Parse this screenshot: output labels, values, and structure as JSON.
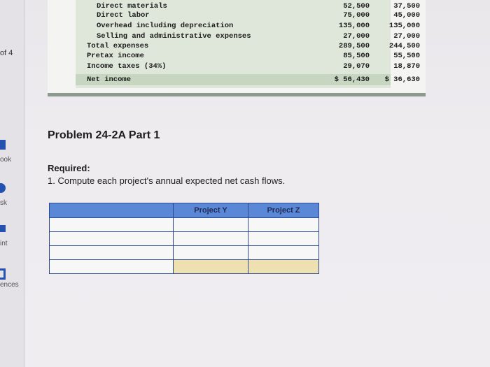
{
  "sidebar": {
    "page_indicator": "of 4",
    "items": [
      {
        "label": "ook"
      },
      {
        "label": "sk"
      },
      {
        "label": "int"
      },
      {
        "label": "ences"
      }
    ]
  },
  "statement": {
    "rows": [
      {
        "label": "Direct materials",
        "y": "52,500",
        "z": "37,500"
      },
      {
        "label": "Direct labor",
        "y": "75,000",
        "z": "45,000"
      },
      {
        "label": "Overhead including depreciation",
        "y": "135,000",
        "z": "135,000"
      },
      {
        "label": "Selling and administrative expenses",
        "y": "27,000",
        "z": "27,000"
      },
      {
        "label": "Total expenses",
        "y": "289,500",
        "z": "244,500"
      },
      {
        "label": "Pretax income",
        "y": "85,500",
        "z": "55,500"
      },
      {
        "label": "Income taxes (34%)",
        "y": "29,070",
        "z": "18,870"
      },
      {
        "label": "Net income",
        "y": "$ 56,430",
        "z": "$ 36,630"
      }
    ]
  },
  "problem": {
    "title": "Problem 24-2A Part 1",
    "required_label": "Required:",
    "required_text": "1. Compute each project's annual expected net cash flows."
  },
  "entry_table": {
    "headers": [
      "",
      "Project Y",
      "Project Z"
    ],
    "rows": [
      {
        "label": "",
        "y": "",
        "z": ""
      },
      {
        "label": "",
        "y": "",
        "z": ""
      },
      {
        "label": "",
        "y": "",
        "z": ""
      },
      {
        "label": "",
        "y": "",
        "z": ""
      }
    ]
  },
  "colors": {
    "header_blue": "#5a87d6",
    "total_cell": "#eee0b0",
    "statement_bg": "#dfe7da"
  }
}
